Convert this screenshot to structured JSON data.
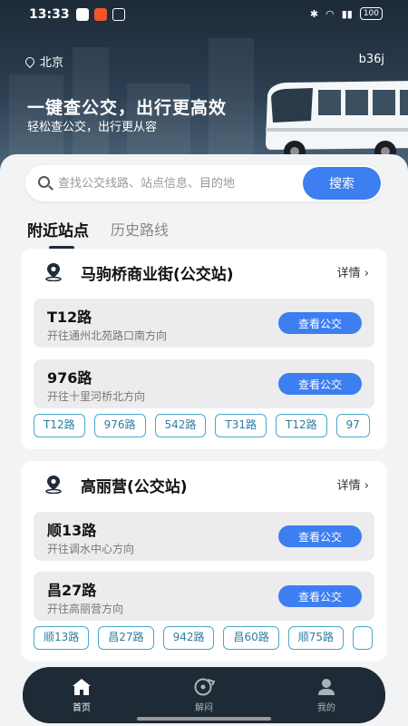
{
  "status_bar": {
    "time": "13:33",
    "battery": "100"
  },
  "header": {
    "city": "北京",
    "user_id": "b36j",
    "title": "一键查公交，出行更高效",
    "subtitle": "轻松查公交，出行更从容"
  },
  "search": {
    "placeholder": "查找公交线路、站点信息、目的地",
    "button": "搜索"
  },
  "tabs": [
    {
      "label": "附近站点",
      "active": true
    },
    {
      "label": "历史路线",
      "active": false
    }
  ],
  "stations": [
    {
      "name": "马驹桥商业街(公交站)",
      "detail_label": "详情",
      "routes": [
        {
          "name": "T12路",
          "direction": "开往通州北苑路口南方向",
          "button": "查看公交"
        },
        {
          "name": "976路",
          "direction": "开往十里河桥北方向",
          "button": "查看公交"
        }
      ],
      "chips": [
        "T12路",
        "976路",
        "542路",
        "T31路",
        "T12路",
        "97"
      ]
    },
    {
      "name": "高丽营(公交站)",
      "detail_label": "详情",
      "routes": [
        {
          "name": "顺13路",
          "direction": "开往调水中心方向",
          "button": "查看公交"
        },
        {
          "name": "昌27路",
          "direction": "开往高丽营方向",
          "button": "查看公交"
        }
      ],
      "chips": [
        "顺13路",
        "昌27路",
        "942路",
        "昌60路",
        "顺75路",
        ""
      ]
    }
  ],
  "nav": [
    {
      "label": "首页",
      "icon": "home-icon",
      "active": true
    },
    {
      "label": "解闷",
      "icon": "disc-icon",
      "active": false
    },
    {
      "label": "我的",
      "icon": "user-icon",
      "active": false
    }
  ],
  "colors": {
    "accent": "#3d7ef0",
    "chip_border": "#4aa7c9",
    "nav_bg": "#1e2a35"
  }
}
